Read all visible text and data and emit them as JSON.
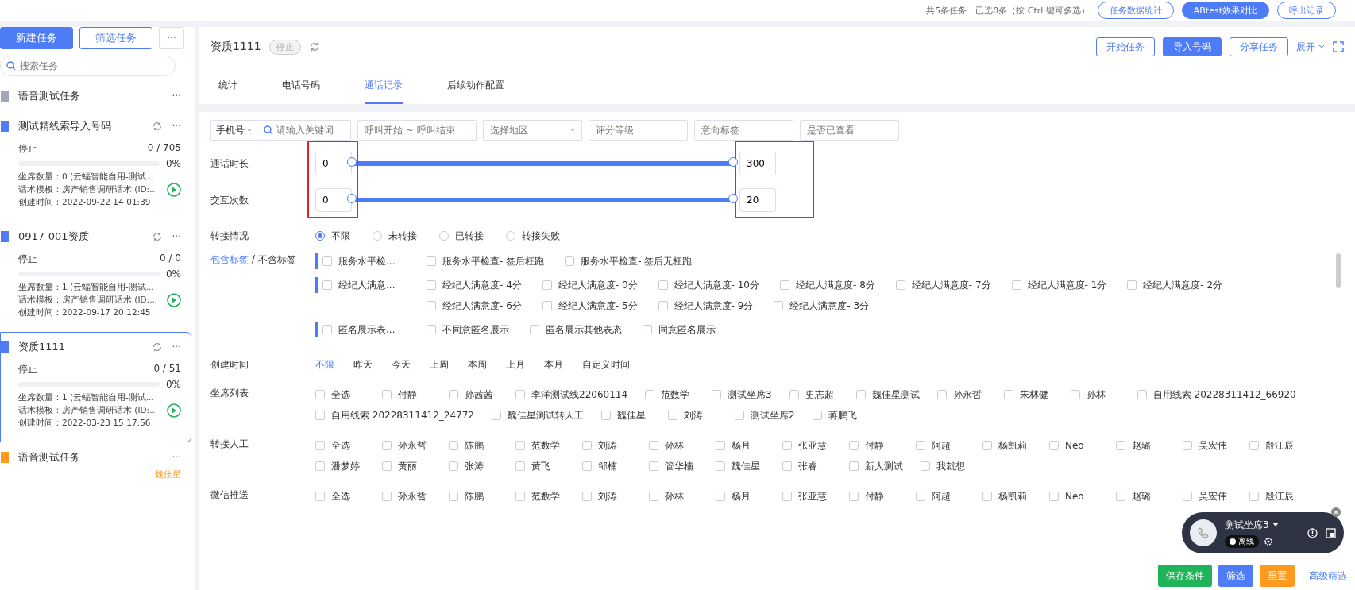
{
  "top_bar": {
    "summary": "共5条任务，已选0条（按 Ctrl 键可多选）",
    "buttons": [
      {
        "label": "任务数据统计",
        "primary": false
      },
      {
        "label": "ABtest效果对比",
        "primary": true
      },
      {
        "label": "呼出记录",
        "primary": false
      }
    ]
  },
  "sidebar": {
    "buttons": [
      {
        "label": "新建任务",
        "primary": true
      },
      {
        "label": "筛选任务",
        "primary": false
      }
    ],
    "more": "···",
    "search_placeholder": "搜索任务",
    "tasks": [
      {
        "kind": "collapsed",
        "title": "语音测试任务",
        "color": "#a3a6b4",
        "selected": false,
        "more": "···"
      },
      {
        "kind": "detail",
        "title": "测试精线索导入号码",
        "color": "#4e7cf6",
        "selected": false,
        "more": "···",
        "status": "停止",
        "count": "0 / 705",
        "level": 0,
        "percent": "0%",
        "seats": "坐席数量：0 (云蝠智能自用-测试...",
        "script": "话术模板：房产销售调研话术 (ID:...",
        "created": "创建时间：2022-09-22 14:01:39"
      },
      {
        "kind": "detail",
        "title": "0917-001资质",
        "color": "#4e7cf6",
        "selected": false,
        "more": "···",
        "status": "停止",
        "count": "0 / 0",
        "level": 0,
        "percent": "0%",
        "seats": "坐席数量：1 (云蝠智能自用-测试...",
        "script": "话术模板：房产销售调研话术 (ID:...",
        "created": "创建时间：2022-09-17 20:12:45"
      },
      {
        "kind": "detail",
        "title": "资质1111",
        "color": "#4e7cf6",
        "selected": true,
        "more": "···",
        "status": "停止",
        "count": "0 / 51",
        "level": 0,
        "percent": "0%",
        "seats": "坐席数量：1 (云蝠智能自用-测试...",
        "script": "话术模板：房产销售调研话术 (ID:...",
        "created": "创建时间：2022-03-23 15:17:56"
      },
      {
        "kind": "owner",
        "title": "语音测试任务",
        "color": "#ff9a1f",
        "selected": false,
        "more": "···",
        "owner": "魏佳星"
      }
    ]
  },
  "task": {
    "title": "资质1111",
    "status": "停止",
    "actions": [
      {
        "label": "开始任务",
        "primary": false
      },
      {
        "label": "导入号码",
        "primary": true
      },
      {
        "label": "分享任务",
        "primary": false
      }
    ],
    "expand": "展开",
    "tabs": [
      {
        "label": "统计",
        "selected": false
      },
      {
        "label": "电话号码",
        "selected": false
      },
      {
        "label": "通话记录",
        "selected": true
      },
      {
        "label": "后续动作配置",
        "selected": false
      }
    ]
  },
  "filters": {
    "search": {
      "type": "手机号",
      "placeholder": "请输入关键词"
    },
    "fields": [
      {
        "placeholder": "呼叫开始 ~ 呼叫结束",
        "kind": "range"
      },
      {
        "placeholder": "选择地区",
        "kind": "select"
      },
      {
        "placeholder": "评分等级",
        "kind": "text"
      },
      {
        "placeholder": "意向标签",
        "kind": "text"
      },
      {
        "placeholder": "是否已查看",
        "kind": "text"
      }
    ],
    "range_highlight": true,
    "sliders": [
      {
        "label": "通话时长",
        "min": "0",
        "max": "300",
        "level": 1
      },
      {
        "label": "交互次数",
        "min": "0",
        "max": "20",
        "level": 1
      }
    ],
    "transfer": {
      "label": "转接情况",
      "options": [
        {
          "label": "不限",
          "selected": true
        },
        {
          "label": "未转接",
          "selected": false
        },
        {
          "label": "已转接",
          "selected": false
        },
        {
          "label": "转接失败",
          "selected": false
        }
      ]
    },
    "tag_modes": [
      {
        "label": "包含标签",
        "selected": true
      },
      {
        "label": "不含标签",
        "selected": false
      }
    ],
    "tag_separator": "/",
    "tag_groups": [
      {
        "name": "服务水平检...",
        "checked": false,
        "items": [
          {
            "label": "服务水平检查- 签后枉跑",
            "checked": false
          },
          {
            "label": "服务水平检查- 签后无枉跑",
            "checked": false
          }
        ]
      },
      {
        "name": "经纪人满意...",
        "checked": false,
        "items": [
          {
            "label": "经纪人满意度- 4分",
            "checked": false
          },
          {
            "label": "经纪人满意度- 0分",
            "checked": false
          },
          {
            "label": "经纪人满意度- 10分",
            "checked": false
          },
          {
            "label": "经纪人满意度- 8分",
            "checked": false
          },
          {
            "label": "经纪人满意度- 7分",
            "checked": false
          },
          {
            "label": "经纪人满意度- 1分",
            "checked": false
          },
          {
            "label": "经纪人满意度- 2分",
            "checked": false
          },
          {
            "label": "经纪人满意度- 6分",
            "checked": false
          },
          {
            "label": "经纪人满意度- 5分",
            "checked": false
          },
          {
            "label": "经纪人满意度- 9分",
            "checked": false
          },
          {
            "label": "经纪人满意度- 3分",
            "checked": false
          }
        ]
      },
      {
        "name": "匿名展示表...",
        "checked": false,
        "items": [
          {
            "label": "不同意匿名展示",
            "checked": false
          },
          {
            "label": "匿名展示其他表态",
            "checked": false
          },
          {
            "label": "同意匿名展示",
            "checked": false
          }
        ]
      }
    ],
    "created": {
      "label": "创建时间",
      "options": [
        {
          "label": "不限",
          "selected": true
        },
        {
          "label": "昨天",
          "selected": false
        },
        {
          "label": "今天",
          "selected": false
        },
        {
          "label": "上周",
          "selected": false
        },
        {
          "label": "本周",
          "selected": false
        },
        {
          "label": "上月",
          "selected": false
        },
        {
          "label": "本月",
          "selected": false
        },
        {
          "label": "自定义时间",
          "selected": false
        }
      ]
    },
    "lists": [
      {
        "label": "坐席列表",
        "items": [
          {
            "label": "全选",
            "checked": false
          },
          {
            "label": "付静",
            "checked": false
          },
          {
            "label": "孙茜茜",
            "checked": false
          },
          {
            "label": "李洋测试线22060114",
            "checked": false
          },
          {
            "label": "范数学",
            "checked": false
          },
          {
            "label": "测试坐席3",
            "checked": false
          },
          {
            "label": "史志超",
            "checked": false
          },
          {
            "label": "魏佳星测试",
            "checked": false
          },
          {
            "label": "孙永哲",
            "checked": false
          },
          {
            "label": "朱林健",
            "checked": false
          },
          {
            "label": "孙林",
            "checked": false
          },
          {
            "label": "自用线索 20228311412_66920",
            "checked": false
          },
          {
            "label": "自用线索 20228311412_24772",
            "checked": false
          },
          {
            "label": "魏佳星测试转人工",
            "checked": false
          },
          {
            "label": "魏佳星",
            "checked": false
          },
          {
            "label": "刘涛",
            "checked": false
          },
          {
            "label": "测试坐席2",
            "checked": false
          },
          {
            "label": "蒋鹏飞",
            "checked": false
          }
        ]
      },
      {
        "label": "转接人工",
        "items": [
          {
            "label": "全选",
            "checked": false
          },
          {
            "label": "孙永哲",
            "checked": false
          },
          {
            "label": "陈鹏",
            "checked": false
          },
          {
            "label": "范数学",
            "checked": false
          },
          {
            "label": "刘涛",
            "checked": false
          },
          {
            "label": "孙林",
            "checked": false
          },
          {
            "label": "杨月",
            "checked": false
          },
          {
            "label": "张亚慧",
            "checked": false
          },
          {
            "label": "付静",
            "checked": false
          },
          {
            "label": "阿超",
            "checked": false
          },
          {
            "label": "杨凯莉",
            "checked": false
          },
          {
            "label": "Neo",
            "checked": false
          },
          {
            "label": "赵璐",
            "checked": false
          },
          {
            "label": "吴宏伟",
            "checked": false
          },
          {
            "label": "殷江辰",
            "checked": false
          },
          {
            "label": "潘梦婷",
            "checked": false
          },
          {
            "label": "黄丽",
            "checked": false
          },
          {
            "label": "张涛",
            "checked": false
          },
          {
            "label": "黄飞",
            "checked": false
          },
          {
            "label": "邹楠",
            "checked": false
          },
          {
            "label": "管华楠",
            "checked": false
          },
          {
            "label": "魏佳星",
            "checked": false
          },
          {
            "label": "张睿",
            "checked": false
          },
          {
            "label": "新人测试",
            "checked": false
          },
          {
            "label": "我就想",
            "checked": false
          }
        ]
      },
      {
        "label": "微信推送",
        "items": [
          {
            "label": "全选",
            "checked": false
          },
          {
            "label": "孙永哲",
            "checked": false
          },
          {
            "label": "陈鹏",
            "checked": false
          },
          {
            "label": "范数学",
            "checked": false
          },
          {
            "label": "刘涛",
            "checked": false
          },
          {
            "label": "孙林",
            "checked": false
          },
          {
            "label": "杨月",
            "checked": false
          },
          {
            "label": "张亚慧",
            "checked": false
          },
          {
            "label": "付静",
            "checked": false
          },
          {
            "label": "阿超",
            "checked": false
          },
          {
            "label": "杨凯莉",
            "checked": false
          },
          {
            "label": "Neo",
            "checked": false
          },
          {
            "label": "赵璐",
            "checked": false
          },
          {
            "label": "吴宏伟",
            "checked": false
          },
          {
            "label": "殷江辰",
            "checked": false
          }
        ]
      }
    ],
    "actions": [
      {
        "label": "保存条件",
        "kind": "save"
      },
      {
        "label": "筛选",
        "kind": "filter"
      },
      {
        "label": "重置",
        "kind": "reset"
      },
      {
        "label": "高级筛选",
        "kind": "advanced"
      }
    ]
  },
  "agent_widget": {
    "name": "测试坐席3",
    "status": "离线"
  }
}
